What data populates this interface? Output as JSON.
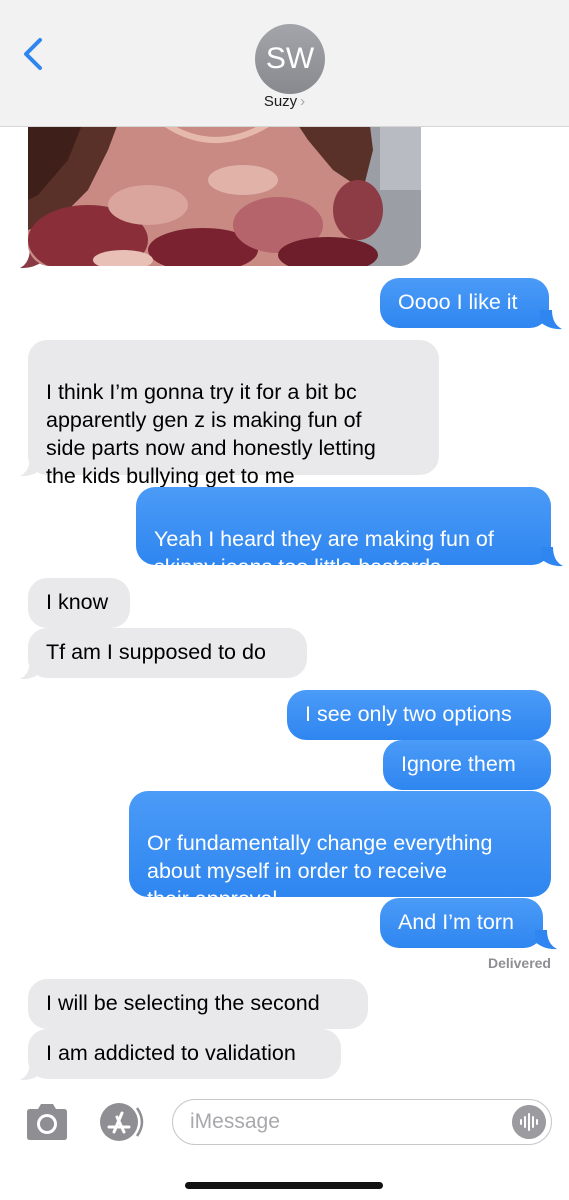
{
  "header": {
    "avatar_initials": "SW",
    "contact_name": "Suzy",
    "chevron": "›",
    "back_icon": "chevron-left-icon"
  },
  "colors": {
    "outgoing": "#2f86f0",
    "incoming": "#e9e9eb",
    "header_bg": "#f2f2f2",
    "back_blue": "#2f86f0"
  },
  "messages": [
    {
      "side": "in",
      "type": "image"
    },
    {
      "side": "out",
      "text": "Oooo I like it"
    },
    {
      "side": "in",
      "text": "I think I’m gonna try it for a bit bc\napparently gen z is making fun of\nside parts now and honestly letting\nthe kids bullying get to me"
    },
    {
      "side": "out",
      "text": "Yeah I heard they are making fun of\nskinny jeans too little bastards"
    },
    {
      "side": "in",
      "text": "I know"
    },
    {
      "side": "in",
      "text": "Tf am I supposed to do"
    },
    {
      "side": "out",
      "text": "I see only two options"
    },
    {
      "side": "out",
      "text": "Ignore them"
    },
    {
      "side": "out",
      "text": "Or fundamentally change everything\nabout myself in order to receive\ntheir approval"
    },
    {
      "side": "out",
      "text": "And I’m torn"
    },
    {
      "side": "in",
      "text": "I will be selecting the second"
    },
    {
      "side": "in",
      "text": "I am addicted to validation"
    }
  ],
  "status": {
    "delivered": "Delivered"
  },
  "input_bar": {
    "placeholder": "iMessage",
    "camera_icon": "camera-icon",
    "appstore_icon": "app-store-icon",
    "audio_icon": "audio-waveform-icon"
  }
}
